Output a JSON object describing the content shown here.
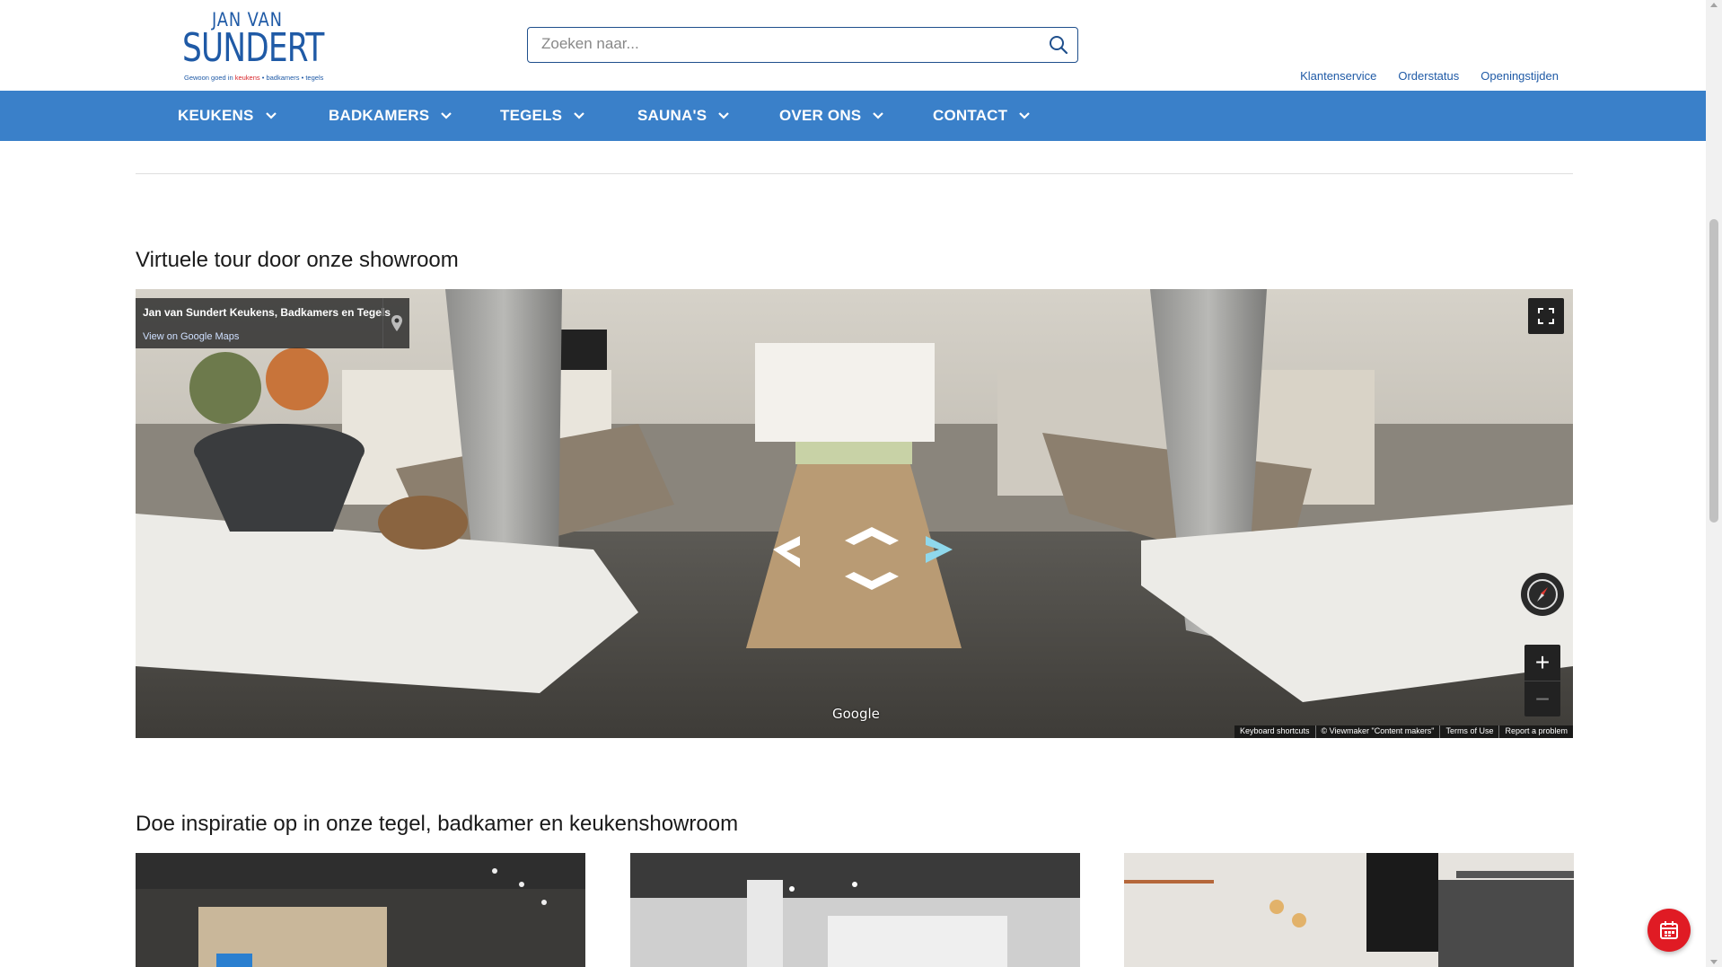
{
  "logo": {
    "top": "JAN VAN",
    "main": "SUNDERT",
    "tagline_prefix": "Gewoon goed in ",
    "tagline_keukens": "keukens",
    "tagline_rest": " • badkamers • tegels"
  },
  "search": {
    "placeholder": "Zoeken naar..."
  },
  "toplinks": [
    "Klantenservice",
    "Orderstatus",
    "Openingstijden"
  ],
  "nav": [
    "KEUKENS",
    "BADKAMERS",
    "TEGELS",
    "SAUNA'S",
    "OVER ONS",
    "CONTACT"
  ],
  "sections": {
    "tour_title": "Virtuele tour door onze showroom",
    "inspiration_title": "Doe inspiratie op in onze tegel, badkamer en keukenshowroom"
  },
  "streetview": {
    "place_name": "Jan van Sundert Keukens, Badkamers en Tegels",
    "maps_link": "View on Google Maps",
    "brand": "Google",
    "footer": [
      "Keyboard shortcuts",
      "© Viewmaker \"Content makers\"",
      "Terms of Use",
      "Report a problem"
    ]
  },
  "colors": {
    "brand_blue": "#1f5aa6",
    "nav_blue": "#3a80c9",
    "accent_red": "#e01b24"
  },
  "icons": {
    "search": "search-icon",
    "chevron": "chevron-down-icon",
    "fullscreen": "fullscreen-icon",
    "compass": "compass-icon",
    "pin": "map-pin-icon",
    "calendar": "calendar-icon"
  }
}
